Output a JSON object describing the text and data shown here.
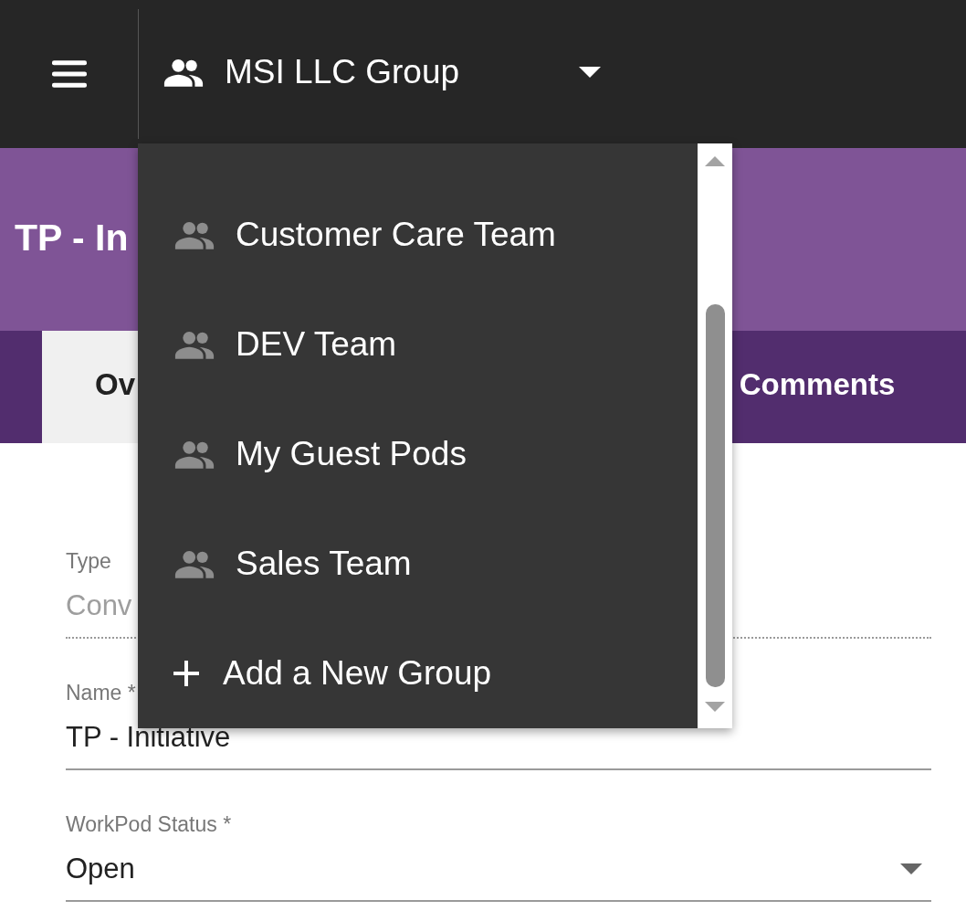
{
  "top_bar": {
    "group_name": "MSI LLC Group"
  },
  "header": {
    "title": "TP - In"
  },
  "tabs": [
    {
      "label": "Ov",
      "selected": true
    },
    {
      "label": "Comments",
      "selected": false
    }
  ],
  "form": {
    "fields": [
      {
        "kind": "readonly",
        "label": "Type",
        "value": "Conv"
      },
      {
        "kind": "text",
        "label": "Name *",
        "value": "TP - Initiative"
      },
      {
        "kind": "select",
        "label": "WorkPod Status *",
        "value": "Open"
      }
    ]
  },
  "group_menu": {
    "items": [
      {
        "kind": "group",
        "label": "Customer Care Team"
      },
      {
        "kind": "group",
        "label": "DEV Team"
      },
      {
        "kind": "group",
        "label": "My Guest Pods"
      },
      {
        "kind": "group",
        "label": "Sales Team"
      },
      {
        "kind": "add",
        "label": "Add a New Group"
      }
    ]
  }
}
